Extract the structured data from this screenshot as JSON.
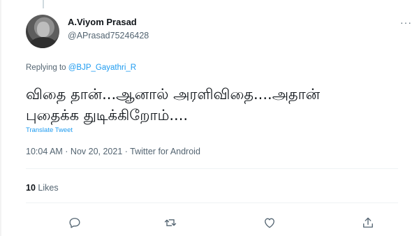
{
  "tweet": {
    "author_name": "A.Viyom Prasad",
    "author_handle": "@APrasad75246428",
    "more_label": "···",
    "replying_prefix": "Replying to",
    "replying_to": "@BJP_Gayathri_R",
    "text_line1": "விதை தான்...ஆனால் அரளிவிதை....அதான்",
    "text_line2": "புதைக்க துடிக்கிறோம்....",
    "translate_label": "Translate Tweet",
    "timestamp": "10:04 AM · Nov 20, 2021 · Twitter for Android",
    "likes_count": "10",
    "likes_label": "Likes"
  },
  "actions": {
    "reply_icon": "reply-icon",
    "retweet_icon": "retweet-icon",
    "like_icon": "like-icon",
    "share_icon": "share-icon"
  },
  "colors": {
    "link": "#1d9bf0",
    "secondary_text": "#536471",
    "primary_text": "#0f1419",
    "divider": "#eff3f4"
  }
}
